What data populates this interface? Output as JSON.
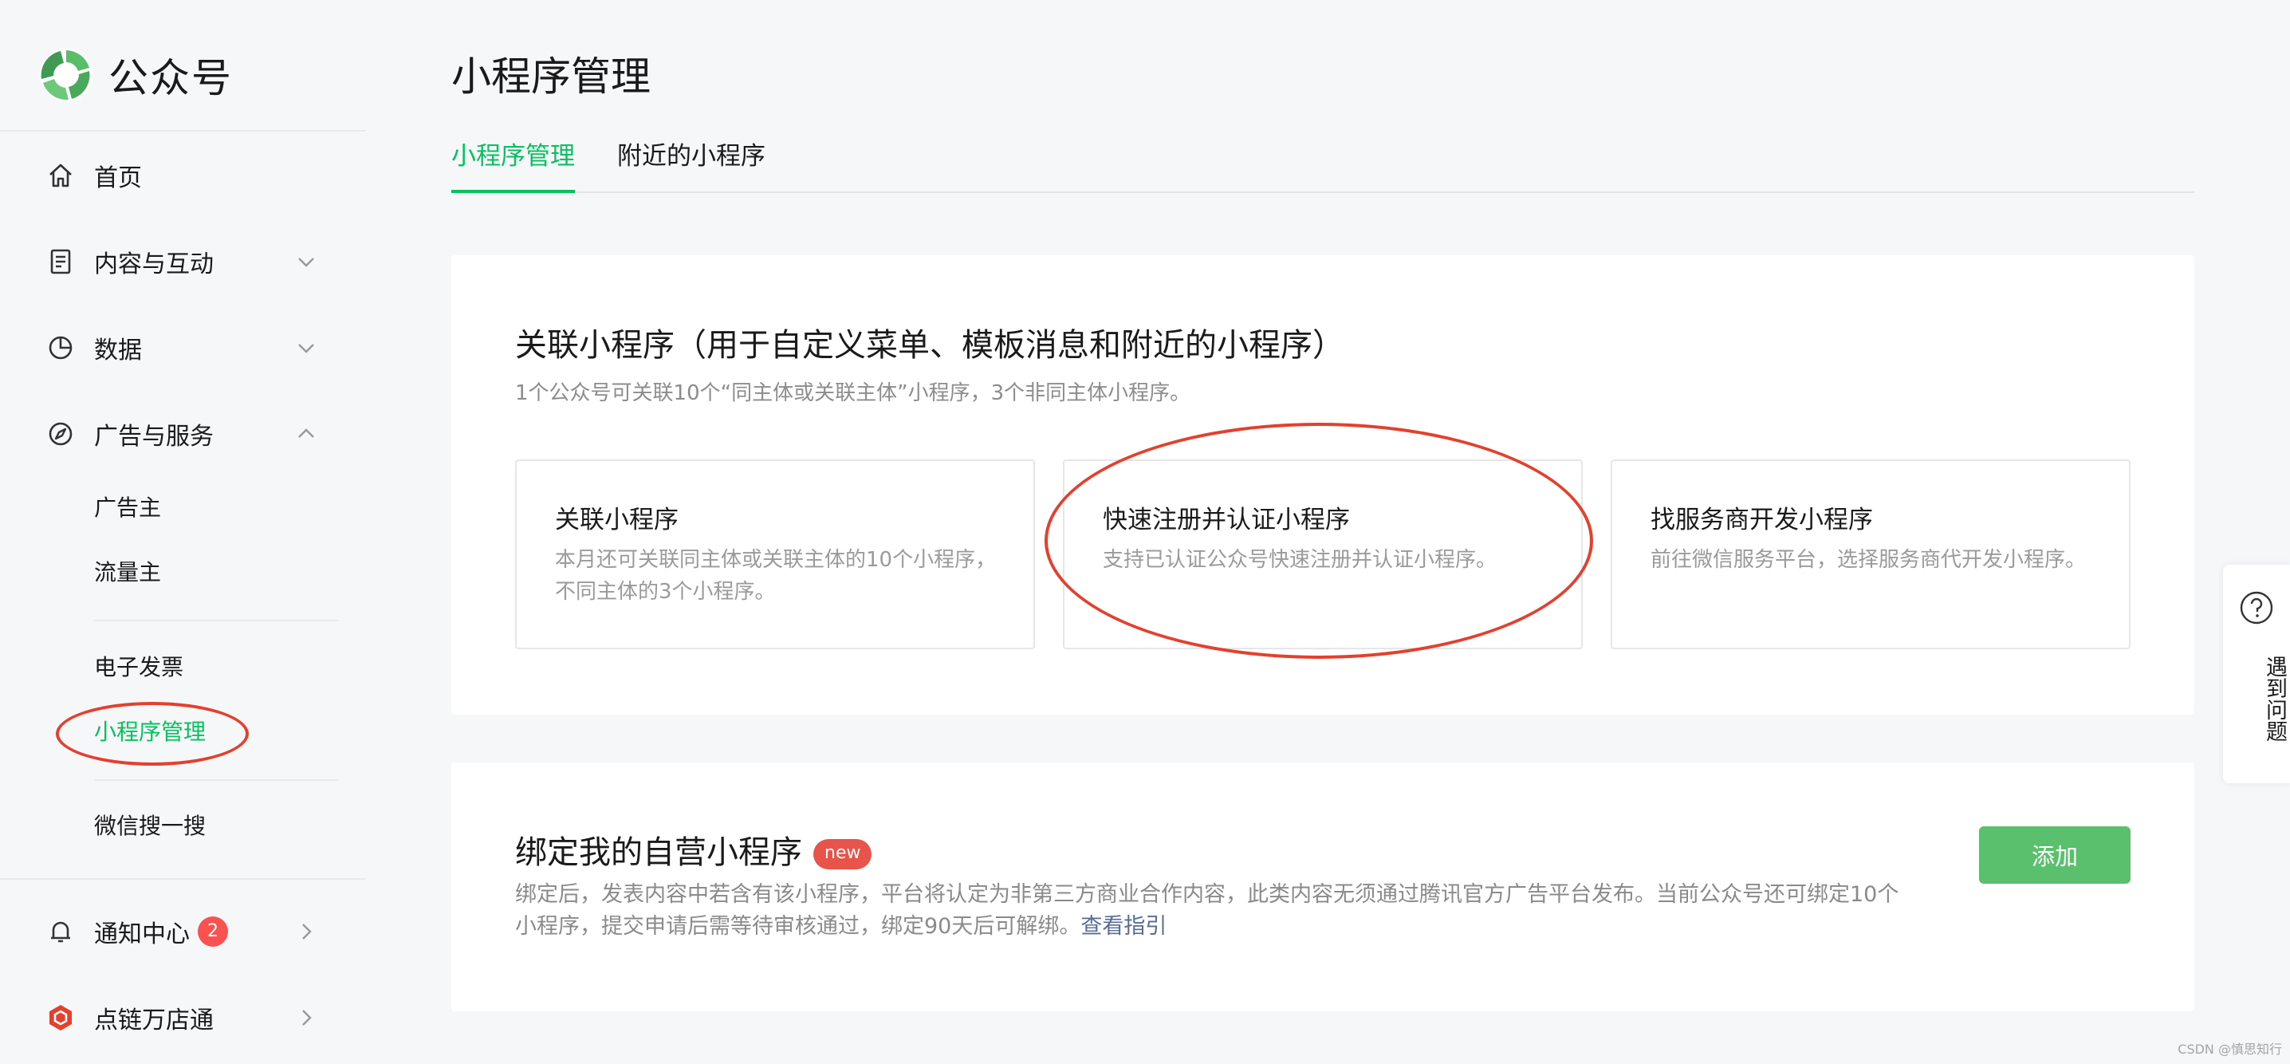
{
  "sidebar": {
    "logo_text": "公众号",
    "nav": {
      "home": "首页",
      "content": "内容与互动",
      "data": "数据",
      "ads": "广告与服务",
      "notify": "通知中心",
      "notify_badge": "2",
      "shop": "点链万店通"
    },
    "sub": {
      "advertiser": "广告主",
      "publisher": "流量主",
      "invoice": "电子发票",
      "miniprogram": "小程序管理",
      "search": "微信搜一搜"
    }
  },
  "main": {
    "title": "小程序管理",
    "tabs": [
      "小程序管理",
      "附近的小程序"
    ],
    "link_card": {
      "title": "关联小程序（用于自定义菜单、模板消息和附近的小程序）",
      "subtitle": "1个公众号可关联10个“同主体或关联主体”小程序，3个非同主体小程序。",
      "options": [
        {
          "title": "关联小程序",
          "desc": "本月还可关联同主体或关联主体的10个小程序，不同主体的3个小程序。"
        },
        {
          "title": "快速注册并认证小程序",
          "desc": "支持已认证公众号快速注册并认证小程序。"
        },
        {
          "title": "找服务商开发小程序",
          "desc": "前往微信服务平台，选择服务商代开发小程序。"
        }
      ]
    },
    "bind_card": {
      "title": "绑定我的自营小程序",
      "badge": "new",
      "desc": "绑定后，发表内容中若含有该小程序，平台将认定为非第三方商业合作内容，此类内容无须通过腾讯官方广告平台发布。当前公众号还可绑定10个小程序，提交申请后需等待审核通过，绑定90天后可解绑。",
      "link": "查看指引",
      "add_button": "添加"
    }
  },
  "help": {
    "label": "遇到问题"
  },
  "watermark": "CSDN @慎思知行",
  "colors": {
    "accent": "#07c160",
    "annotation": "#e3402e",
    "badge": "#fa5151",
    "button": "#5ac06d",
    "link": "#576b95"
  }
}
